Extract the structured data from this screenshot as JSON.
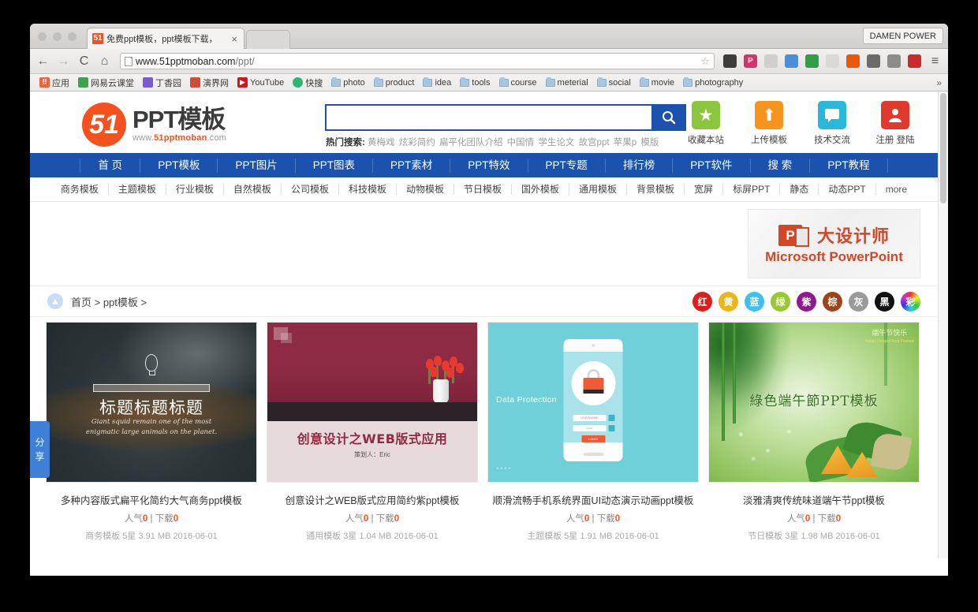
{
  "browser": {
    "tab_title": "免费ppt模板，ppt模板下载，",
    "tab_favicon": "51",
    "tab_close": "×",
    "profile_label": "DAMEN POWER",
    "back_icon": "←",
    "forward_icon": "→",
    "reload_icon": "C",
    "home_icon": "⌂",
    "url_host": "www.51pptmoban.com",
    "url_path": "/ppt/",
    "star_icon": "☆",
    "menu_icon": "≡",
    "overflow_icon": "»",
    "bookmarks": [
      {
        "label": "应用",
        "icon": "apps-grid-icon",
        "color": "#e8663d"
      },
      {
        "label": "网易云课堂",
        "icon": "book-icon",
        "color": "#3fa34d"
      },
      {
        "label": "丁香园",
        "icon": "leaf-icon",
        "color": "#7a5bd0"
      },
      {
        "label": "演界网",
        "icon": "mountain-icon",
        "color": "#cf4b3a"
      },
      {
        "label": "YouTube",
        "icon": "youtube-icon",
        "color": "#cc181e"
      },
      {
        "label": "快搜",
        "icon": "search-circle-icon",
        "color": "#2bb673"
      },
      {
        "label": "photo",
        "icon": "folder-icon",
        "color": ""
      },
      {
        "label": "product",
        "icon": "folder-icon",
        "color": ""
      },
      {
        "label": "idea",
        "icon": "folder-icon",
        "color": ""
      },
      {
        "label": "tools",
        "icon": "folder-icon",
        "color": ""
      },
      {
        "label": "course",
        "icon": "folder-icon",
        "color": ""
      },
      {
        "label": "meterial",
        "icon": "folder-icon",
        "color": ""
      },
      {
        "label": "social",
        "icon": "folder-icon",
        "color": ""
      },
      {
        "label": "movie",
        "icon": "folder-icon",
        "color": ""
      },
      {
        "label": "photography",
        "icon": "folder-icon",
        "color": ""
      }
    ]
  },
  "site": {
    "logo": {
      "mark": "51",
      "title": "PPT模板",
      "sub_prefix": "www.",
      "sub_brand": "51pptmoban",
      "sub_suffix": ".com"
    },
    "search": {
      "value": "",
      "placeholder": "",
      "button_icon": "search-icon"
    },
    "hot": {
      "label": "热门搜索:",
      "terms": [
        "黄梅戏",
        "炫彩简约",
        "扁平化团队介绍",
        "中国情",
        "学生论文",
        "故宫ppt",
        "苹果p",
        "模版"
      ]
    },
    "quicklinks": [
      {
        "label": "收藏本站",
        "icon": "star-icon",
        "glyph": "★",
        "color": "#8cc63f"
      },
      {
        "label": "上传模板",
        "icon": "upload-icon",
        "glyph": "⬆",
        "color": "#f7941e"
      },
      {
        "label": "技术交流",
        "icon": "chat-icon",
        "glyph": "💬",
        "color": "#29b8d8"
      },
      {
        "label": "注册 登陆",
        "icon": "user-icon",
        "glyph": "👤",
        "color": "#e03a2f"
      }
    ],
    "mainnav": [
      "首 页",
      "PPT模板",
      "PPT图片",
      "PPT图表",
      "PPT素材",
      "PPT特效",
      "PPT专题",
      "排行榜",
      "PPT软件",
      "搜 索",
      "PPT教程"
    ],
    "subnav": [
      "商务模板",
      "主题模板",
      "行业模板",
      "自然模板",
      "公司模板",
      "科技模板",
      "动物模板",
      "节日模板",
      "国外模板",
      "通用模板",
      "背景模板",
      "宽屏",
      "标屏PPT",
      "静态",
      "动态PPT",
      "more"
    ],
    "banner": {
      "cn_text": "大设计师",
      "ms_text": "Microsoft PowerPoint",
      "logo_letter": "P"
    },
    "breadcrumb": {
      "up_icon": "up-arrow-icon",
      "text": "首页 > ppt模板 >"
    },
    "color_filters": [
      {
        "label": "红",
        "color": "#d91f1f"
      },
      {
        "label": "黄",
        "color": "#e8b71a"
      },
      {
        "label": "蓝",
        "color": "#3ec1ea"
      },
      {
        "label": "绿",
        "color": "#9ac832"
      },
      {
        "label": "紫",
        "color": "#8d1b8d"
      },
      {
        "label": "棕",
        "color": "#9e4418"
      },
      {
        "label": "灰",
        "color": "#9b9b9b"
      },
      {
        "label": "黑",
        "color": "#111111"
      },
      {
        "label": "彩",
        "color": "rainbow"
      }
    ],
    "share_tab": {
      "line1": "分",
      "line2": "享"
    }
  },
  "cards": [
    {
      "title": "多种内容版式扁平化简约大气商务ppt模板",
      "pop_label": "人气",
      "pop_value": "0",
      "dl_label": "下载",
      "dl_value": "0",
      "separator": "|",
      "meta": "商务模板 5星 3.91 MB 2016-06-01",
      "thumb": {
        "heading": "标题标题标题",
        "sub": "Giant squid remain one of the most enigmatic large animals on the planet."
      }
    },
    {
      "title": "创意设计之WEB版式应用简约紫ppt模板",
      "pop_label": "人气",
      "pop_value": "0",
      "dl_label": "下载",
      "dl_value": "0",
      "separator": "|",
      "meta": "通用模板 3星 1.04 MB 2016-06-01",
      "thumb": {
        "heading": "创意设计之WEB版式应用",
        "sub": "策划人：Eric"
      }
    },
    {
      "title": "顺滑流畅手机系统界面UI动态演示动画ppt模板",
      "pop_label": "人气",
      "pop_value": "0",
      "dl_label": "下载",
      "dl_value": "0",
      "separator": "|",
      "meta": "主题模板 5星 1.91 MB 2016-06-01",
      "thumb": {
        "heading": "Data Protection",
        "username": "USERNAME",
        "password": "••••••",
        "login": "LOGIN"
      }
    },
    {
      "title": "淡雅清爽传统味道端午节ppt模板",
      "pop_label": "人气",
      "pop_value": "0",
      "dl_label": "下载",
      "dl_value": "0",
      "separator": "|",
      "meta": "节日模板 3星 1.98 MB 2016-06-01",
      "thumb": {
        "heading": "綠色端午節PPT模板",
        "corner1": "端午节快乐",
        "corner2": "Happy Dragon Boat Festival"
      }
    }
  ]
}
